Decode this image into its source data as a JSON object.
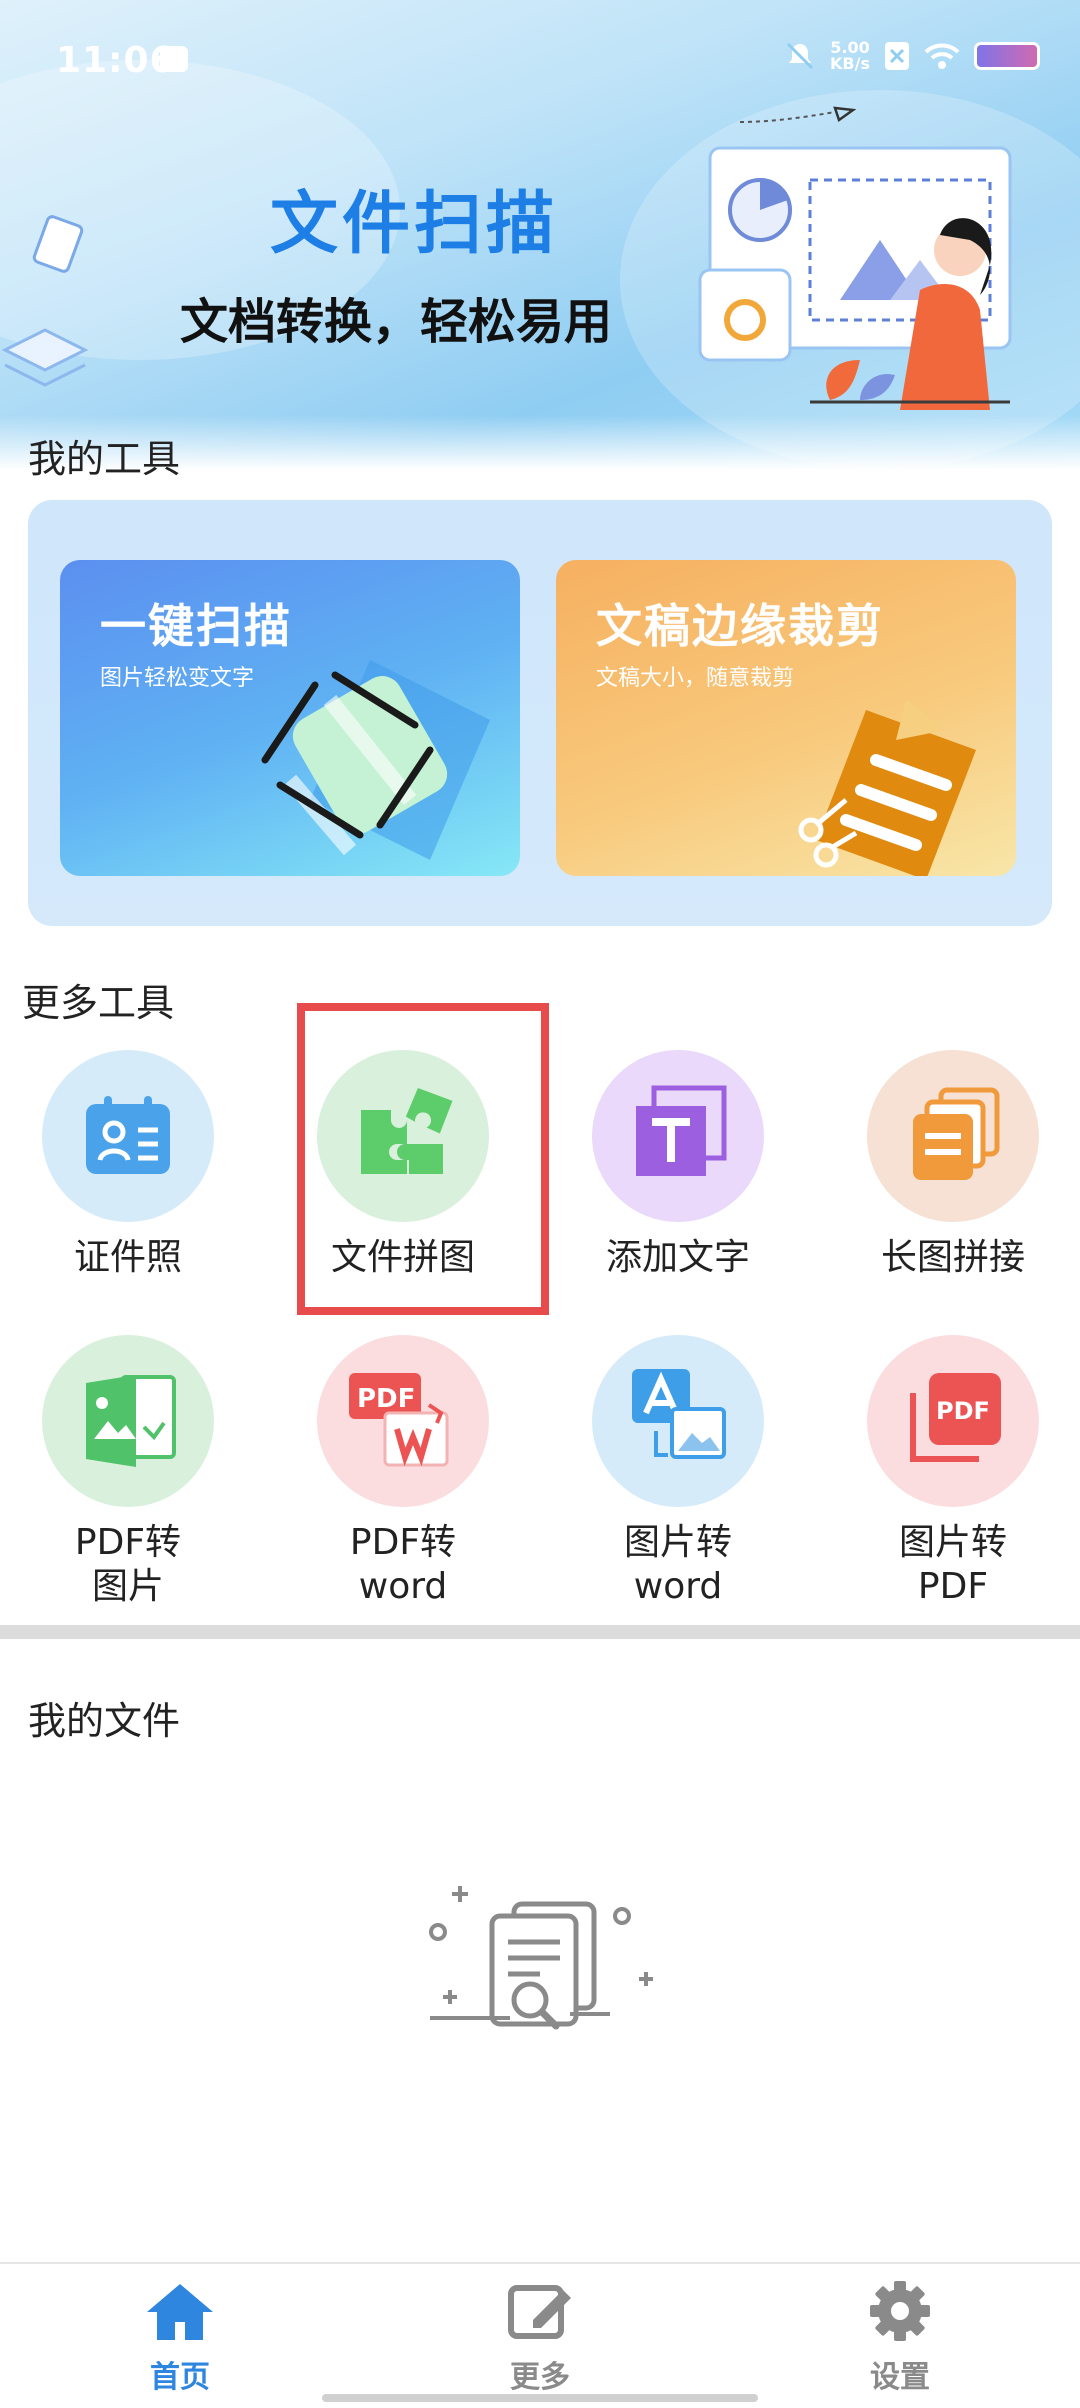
{
  "status_bar": {
    "time": "11:06",
    "speed_value": "5.00",
    "speed_unit": "KB/s"
  },
  "banner": {
    "title": "文件扫描",
    "subtitle": "文档转换，轻松易用"
  },
  "my_tools": {
    "title": "我的工具",
    "items": [
      {
        "title": "一键扫描",
        "subtitle": "图片轻松变文字"
      },
      {
        "title": "文稿边缘裁剪",
        "subtitle": "文稿大小，随意裁剪"
      }
    ]
  },
  "more_tools": {
    "title": "更多工具",
    "items": [
      {
        "label": "证件照",
        "icon": "id-card-icon",
        "color": "#4aa3ea"
      },
      {
        "label": "文件拼图",
        "icon": "puzzle-icon",
        "color": "#5dcd6b"
      },
      {
        "label": "添加文字",
        "icon": "text-icon",
        "color": "#9b5fe0"
      },
      {
        "label": "长图拼接",
        "icon": "stack-icon",
        "color": "#f09a3c"
      },
      {
        "label_line1": "PDF转",
        "label_line2": "图片",
        "icon": "pdf-to-image-icon",
        "color": "#4fc26a"
      },
      {
        "label_line1": "PDF转",
        "label_line2": "word",
        "icon": "pdf-to-word-icon",
        "color": "#ec5454"
      },
      {
        "label_line1": "图片转",
        "label_line2": "word",
        "icon": "image-to-word-icon",
        "color": "#3e9ee8"
      },
      {
        "label_line1": "图片转",
        "label_line2": "PDF",
        "icon": "image-to-pdf-icon",
        "color": "#ec5454"
      }
    ]
  },
  "my_files": {
    "title": "我的文件"
  },
  "nav": {
    "items": [
      {
        "label": "首页",
        "icon": "home-icon",
        "active": true
      },
      {
        "label": "更多",
        "icon": "edit-icon",
        "active": false
      },
      {
        "label": "设置",
        "icon": "settings-icon",
        "active": false
      }
    ],
    "active_color": "#2e86de",
    "inactive_color": "#8a8a8a"
  }
}
